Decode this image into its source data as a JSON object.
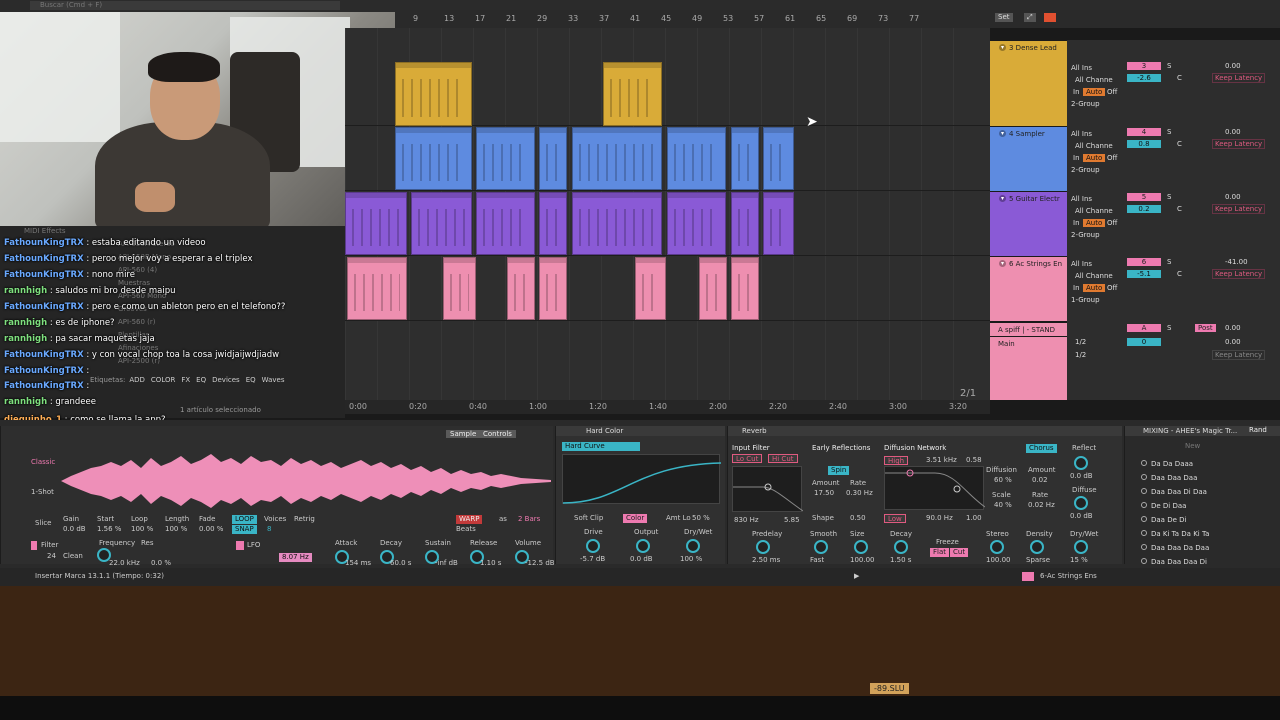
{
  "top": {
    "search_placeholder": "Buscar (Cmd + F)",
    "set_label": "Set"
  },
  "ruler": {
    "bars": [
      "9",
      "13",
      "17",
      "21",
      "29",
      "33",
      "37",
      "41",
      "45",
      "49",
      "53",
      "57",
      "61",
      "65",
      "69",
      "73",
      "77"
    ]
  },
  "timeline": {
    "times": [
      "0:00",
      "0:20",
      "0:40",
      "1:00",
      "1:20",
      "1:40",
      "2:00",
      "2:20",
      "2:40",
      "3:00",
      "3:20"
    ],
    "page": "2/1"
  },
  "tracks": [
    {
      "name": "3 Dense Lead",
      "color": "#d9ab38",
      "input": "All Ins",
      "channel": "All Channe",
      "monitor_in": "In",
      "monitor_auto": "Auto",
      "monitor_off": "Off",
      "output": "2-Group",
      "num": "3",
      "s": "S",
      "value": "-2.6",
      "pan": "C",
      "vol": "0.00",
      "latency": "Keep Latency"
    },
    {
      "name": "4 Sampler",
      "color": "#5e8be0",
      "input": "All Ins",
      "channel": "All Channe",
      "monitor_in": "In",
      "monitor_auto": "Auto",
      "monitor_off": "Off",
      "output": "2-Group",
      "num": "4",
      "s": "S",
      "value": "0.8",
      "pan": "C",
      "vol": "0.00",
      "latency": "Keep Latency"
    },
    {
      "name": "5 Guitar Electr",
      "color": "#8a5ad6",
      "input": "All Ins",
      "channel": "All Channe",
      "monitor_in": "In",
      "monitor_auto": "Auto",
      "monitor_off": "Off",
      "output": "2-Group",
      "num": "5",
      "s": "S",
      "value": "0.2",
      "pan": "C",
      "vol": "0.00",
      "latency": "Keep Latency"
    },
    {
      "name": "6 Ac Strings En",
      "color": "#ee8fb0",
      "input": "All Ins",
      "channel": "All Channe",
      "monitor_in": "In",
      "monitor_auto": "Auto",
      "monitor_off": "Off",
      "output": "1-Group",
      "num": "6",
      "s": "S",
      "value": "-5.1",
      "pan": "C",
      "vol": "-41.00",
      "latency": "Keep Latency"
    }
  ],
  "return_track": {
    "name": "A spiff | - STAND",
    "letter": "A",
    "s": "S",
    "post": "Post",
    "vol": "0.00"
  },
  "main_track": {
    "name": "Main",
    "out1": "1/2",
    "out2": "1/2",
    "value": "0",
    "vol": "0.00",
    "latency": "Keep Latency"
  },
  "browser": {
    "rows": [
      "MIDI Effects",
      "API-550A Stereo",
      "API-550B Mono",
      "API-560 (4)",
      "Muestras",
      "API-560 Mono",
      "Grooves",
      "API-560 (r)",
      "Plantillas",
      "Afinaciones",
      "API-2500 (r)"
    ],
    "tags_label": "Etiquetas:",
    "tags": [
      "ADD",
      "COLOR",
      "FX",
      "EQ",
      "Devices",
      "EQ",
      "Waves"
    ],
    "selection": "1 artículo seleccionado"
  },
  "chat": [
    {
      "user": "FathounKingTRX",
      "msg": ": estaba editando un videoo",
      "cls": "u-blue"
    },
    {
      "user": "FathounKingTRX",
      "msg": ": peroo mejor voy a esperar a el triplex",
      "cls": "u-blue"
    },
    {
      "user": "FathounKingTRX",
      "msg": ": nono mire",
      "cls": "u-blue"
    },
    {
      "user": "rannhigh",
      "msg": ": saludos mi bro desde maipu",
      "cls": "u-green"
    },
    {
      "user": "FathounKingTRX",
      "msg": ": pero e como un ableton pero en el telefono??",
      "cls": "u-blue"
    },
    {
      "user": "rannhigh",
      "msg": ": es de iphone?",
      "cls": "u-green"
    },
    {
      "user": "rannhigh",
      "msg": ": pa sacar maquetas jaja",
      "cls": "u-green"
    },
    {
      "user": "FathounKingTRX",
      "msg": ": y con vocal chop toa la cosa jwidjaijwdjiadw",
      "cls": "u-blue"
    },
    {
      "user": "FathounKingTRX",
      "msg": ":",
      "cls": "u-blue"
    },
    {
      "user": "FathounKingTRX",
      "msg": ":",
      "cls": "u-blue"
    },
    {
      "user": "rannhigh",
      "msg": ": grandeee",
      "cls": "u-green"
    },
    {
      "user": "dieguinho_1",
      "msg": ": como se llama la app?",
      "cls": "u-orange"
    },
    {
      "user": "FathounKingTRX",
      "msg": ": pero tu teni el ableton comprado po ono??",
      "cls": "u-blue"
    }
  ],
  "sampler": {
    "tabs": [
      "Sample",
      "Controls"
    ],
    "mode": "Classic",
    "one_shot": "1-Shot",
    "slice": "Slice",
    "params": [
      {
        "l": "Gain",
        "v": "0.0 dB"
      },
      {
        "l": "Start",
        "v": "1.56 %"
      },
      {
        "l": "Loop",
        "v": "100 %"
      },
      {
        "l": "Length",
        "v": "100 %"
      },
      {
        "l": "Fade",
        "v": "0.00 %"
      }
    ],
    "loop": "LOOP",
    "snap": "SNAP",
    "voices_label": "Voices",
    "voices": "8",
    "retrig": "Retrig",
    "warp": "WARP",
    "as": "as",
    "bars": "2 Bars",
    "beats": "Beats",
    "filter_label": "Filter",
    "freq_label": "Frequency",
    "freq": "22.0 kHz",
    "res_label": "Res",
    "res": "0.0 %",
    "filter_type": "Clean",
    "filter_slope": "24",
    "lfo": "LFO",
    "lfo_rate": "8.07 Hz",
    "env": [
      {
        "l": "Attack",
        "v": "154 ms"
      },
      {
        "l": "Decay",
        "v": "60.0 s"
      },
      {
        "l": "Sustain",
        "v": "-inf dB"
      },
      {
        "l": "Release",
        "v": "1.10 s"
      },
      {
        "l": "Volume",
        "v": "-12.5 dB"
      }
    ]
  },
  "hard_color": {
    "title": "Hard Color",
    "curve": "Hard Curve",
    "soft_clip": "Soft Clip",
    "color": "Color",
    "amt_label": "Amt Lo",
    "amt": "50 %",
    "knobs": [
      {
        "l": "Drive",
        "v": "-5.7 dB"
      },
      {
        "l": "Output",
        "v": "0.0 dB"
      },
      {
        "l": "Dry/Wet",
        "v": "100 %"
      }
    ]
  },
  "reverb": {
    "title": "Reverb",
    "input_filter": "Input Filter",
    "lo_cut": "Lo Cut",
    "hi_cut": "Hi Cut",
    "freq": "830 Hz",
    "width": "5.85",
    "early": "Early Reflections",
    "spin": "Spin",
    "amount_label": "Amount",
    "amount": "17.50",
    "rate_label": "Rate",
    "rate": "0.30 Hz",
    "shape_label": "Shape",
    "shape": "0.50",
    "diffusion": "Diffusion Network",
    "high": "High",
    "high_freq": "3.51 kHz",
    "high_val": "0.58",
    "low": "Low",
    "low_freq": "90.0 Hz",
    "low_val": "1.00",
    "diff_label": "Diffusion",
    "diff_val": "60 %",
    "scale_label": "Scale",
    "scale_val": "40 %",
    "chorus": "Chorus",
    "ch_amount_label": "Amount",
    "ch_amount": "0.02",
    "ch_rate_label": "Rate",
    "ch_rate": "0.02 Hz",
    "reflect_label": "Reflect",
    "reflect": "0.0 dB",
    "diffuse_label": "Diffuse",
    "diffuse": "0.0 dB",
    "predelay_label": "Predelay",
    "predelay": "2.50 ms",
    "smooth_label": "Smooth",
    "smooth": "Fast",
    "size_label": "Size",
    "size": "100.00",
    "decay_label": "Decay",
    "decay": "1.50 s",
    "freeze": "Freeze",
    "flat": "Flat",
    "cut": "Cut",
    "stereo_label": "Stereo",
    "stereo": "100.00",
    "density_label": "Density",
    "density": "Sparse",
    "drywet_label": "Dry/Wet",
    "drywet": "15 %"
  },
  "rack": {
    "title": "MIXING - AHEE's Magic Tr...",
    "rand": "Rand",
    "new": "New",
    "presets": [
      "Da Da Daaa",
      "Daa Daa Daa",
      "Daa Daa Di Daa",
      "De Di Daa",
      "Daa De Di",
      "Da Ki Ta Da Ki Ta",
      "Daa Daa Da Daa",
      "Daa Daa Daa Di"
    ]
  },
  "status": {
    "text": "Insertar Marca 13.1.1 (Tiempo: 0:32)",
    "track": "6-Ac Strings Ens"
  },
  "badge": "-89.SLU"
}
